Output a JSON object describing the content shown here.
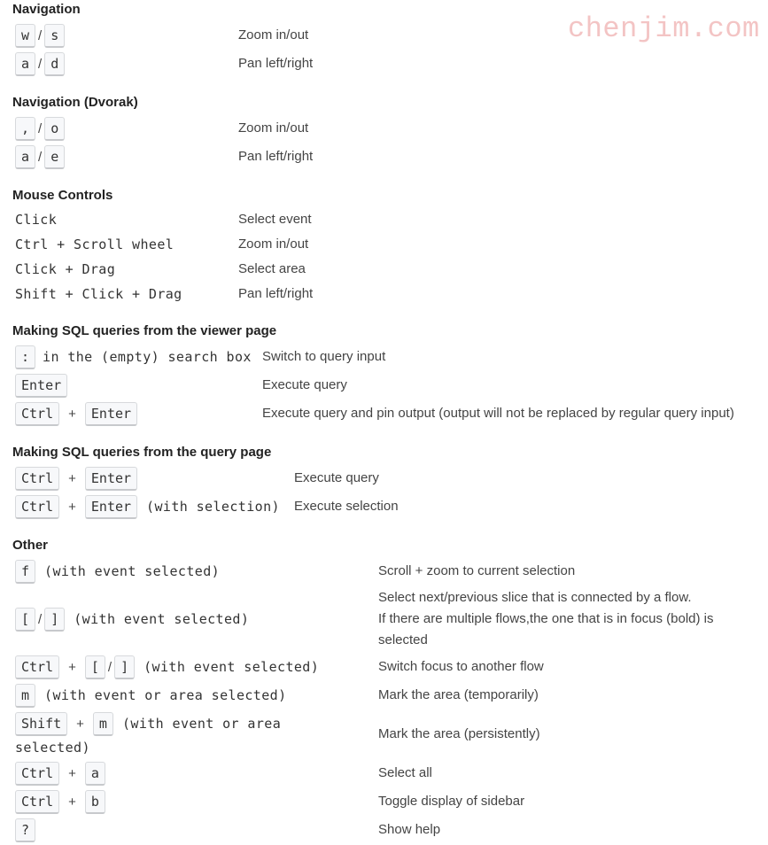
{
  "watermark": "chenjim.com",
  "sections": {
    "nav": {
      "title": "Navigation",
      "rows": [
        {
          "keys": [
            "w",
            "s"
          ],
          "sep": "/",
          "desc": "Zoom in/out"
        },
        {
          "keys": [
            "a",
            "d"
          ],
          "sep": "/",
          "desc": "Pan left/right"
        }
      ]
    },
    "dvorak": {
      "title": "Navigation (Dvorak)",
      "rows": [
        {
          "keys": [
            ",",
            "o"
          ],
          "sep": "/",
          "desc": "Zoom in/out"
        },
        {
          "keys": [
            "a",
            "e"
          ],
          "sep": "/",
          "desc": "Pan left/right"
        }
      ]
    },
    "mouse": {
      "title": "Mouse Controls",
      "rows": [
        {
          "action": "Click",
          "desc": "Select event"
        },
        {
          "action": "Ctrl + Scroll wheel",
          "desc": "Zoom in/out"
        },
        {
          "action": "Click + Drag",
          "desc": "Select area"
        },
        {
          "action": "Shift + Click + Drag",
          "desc": "Pan left/right"
        }
      ]
    },
    "sql_viewer": {
      "title": "Making SQL queries from the viewer page",
      "rows": [
        {
          "keys": [
            ":"
          ],
          "suffix": "in the (empty) search box",
          "desc": "Switch to query input"
        },
        {
          "keys": [
            "Enter"
          ],
          "desc": "Execute query"
        },
        {
          "keys": [
            "Ctrl",
            "Enter"
          ],
          "plus": "+",
          "desc": "Execute query and pin output (output will not be replaced by regular query input)"
        }
      ]
    },
    "sql_query": {
      "title": "Making SQL queries from the query page",
      "rows": [
        {
          "keys": [
            "Ctrl",
            "Enter"
          ],
          "plus": "+",
          "desc": "Execute query"
        },
        {
          "keys": [
            "Ctrl",
            "Enter"
          ],
          "plus": "+",
          "suffix": "(with selection)",
          "desc": "Execute selection"
        }
      ]
    },
    "other": {
      "title": "Other",
      "rows": [
        {
          "keys": [
            "f"
          ],
          "suffix": "(with event selected)",
          "desc": "Scroll + zoom to current selection"
        },
        {
          "keys": [
            "[",
            "]"
          ],
          "sep": "/",
          "suffix": "(with event selected)",
          "desc_lines": [
            "Select next/previous slice that is connected by a flow.",
            "If there are multiple flows,the one that is in focus (bold) is",
            "selected"
          ]
        },
        {
          "keys": [
            "Ctrl",
            "[",
            "]"
          ],
          "plus": "+",
          "sep": "/",
          "suffix": "(with event selected)",
          "desc": "Switch focus to another flow"
        },
        {
          "keys": [
            "m"
          ],
          "suffix": "(with event or area selected)",
          "desc": "Mark the area (temporarily)"
        },
        {
          "keys": [
            "Shift",
            "m"
          ],
          "plus": "+",
          "suffix": "(with event or area",
          "suffix2": "selected)",
          "desc": "Mark the area (persistently)"
        },
        {
          "keys": [
            "Ctrl",
            "a"
          ],
          "plus": "+",
          "desc": "Select all"
        },
        {
          "keys": [
            "Ctrl",
            "b"
          ],
          "plus": "+",
          "desc": "Toggle display of sidebar"
        },
        {
          "keys": [
            "?"
          ],
          "desc": "Show help"
        }
      ]
    }
  }
}
